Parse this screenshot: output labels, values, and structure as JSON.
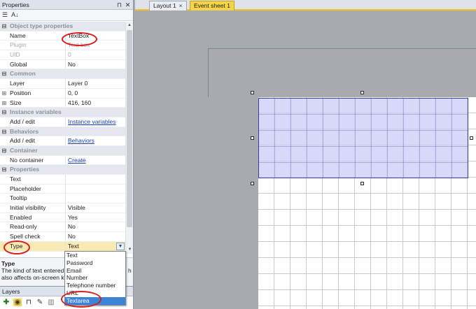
{
  "properties_panel": {
    "title": "Properties",
    "rows": [
      {
        "kind": "cat",
        "name": "Object type properties",
        "expander": "⊟"
      },
      {
        "kind": "prop",
        "name": "Name",
        "value": "TextBox"
      },
      {
        "kind": "dim",
        "name": "Plugin",
        "value": "Text box"
      },
      {
        "kind": "dim",
        "name": "UID",
        "value": "0"
      },
      {
        "kind": "prop",
        "name": "Global",
        "value": "No"
      },
      {
        "kind": "cat",
        "name": "Common",
        "expander": "⊟"
      },
      {
        "kind": "prop",
        "name": "Layer",
        "value": "Layer 0"
      },
      {
        "kind": "prop",
        "name": "Position",
        "value": "0, 0",
        "expander": "⊞"
      },
      {
        "kind": "prop",
        "name": "Size",
        "value": "416, 160",
        "expander": "⊞"
      },
      {
        "kind": "cat",
        "name": "Instance variables",
        "expander": "⊟"
      },
      {
        "kind": "link",
        "name": "Add / edit",
        "value": "Instance variables"
      },
      {
        "kind": "cat",
        "name": "Behaviors",
        "expander": "⊟"
      },
      {
        "kind": "link",
        "name": "Add / edit",
        "value": "Behaviors"
      },
      {
        "kind": "cat",
        "name": "Container",
        "expander": "⊟"
      },
      {
        "kind": "link",
        "name": "No container",
        "value": "Create"
      },
      {
        "kind": "cat",
        "name": "Properties",
        "expander": "⊟"
      },
      {
        "kind": "prop",
        "name": "Text",
        "value": ""
      },
      {
        "kind": "prop",
        "name": "Placeholder",
        "value": ""
      },
      {
        "kind": "prop",
        "name": "Tooltip",
        "value": ""
      },
      {
        "kind": "prop",
        "name": "Initial visibility",
        "value": "Visible"
      },
      {
        "kind": "prop",
        "name": "Enabled",
        "value": "Yes"
      },
      {
        "kind": "prop",
        "name": "Read-only",
        "value": "No"
      },
      {
        "kind": "prop",
        "name": "Spell check",
        "value": "No"
      },
      {
        "kind": "sel",
        "name": "Type",
        "value": "Text"
      }
    ],
    "description": {
      "title": "Type",
      "line1": "The kind of text entered",
      "line1_tail": "h",
      "line2": "also affects on-screen ke"
    }
  },
  "layers_panel": {
    "title": "Layers",
    "tools": [
      "add-icon",
      "eye-icon",
      "lock-icon",
      "pencil-icon",
      "trash-icon"
    ]
  },
  "tabs": [
    {
      "label": "Layout 1",
      "close": "×",
      "active": false
    },
    {
      "label": "Event sheet 1",
      "active": true
    }
  ],
  "type_dropdown": {
    "options": [
      "Text",
      "Password",
      "Email",
      "Number",
      "Telephone number",
      "URL",
      "Textarea"
    ],
    "highlighted": "Textarea"
  },
  "colors": {
    "accent_tab": "#f5d547",
    "selection_highlight": "#3d84d8",
    "annotation_red": "#d81e1e",
    "textbox_fill": "#c8cdf5"
  }
}
